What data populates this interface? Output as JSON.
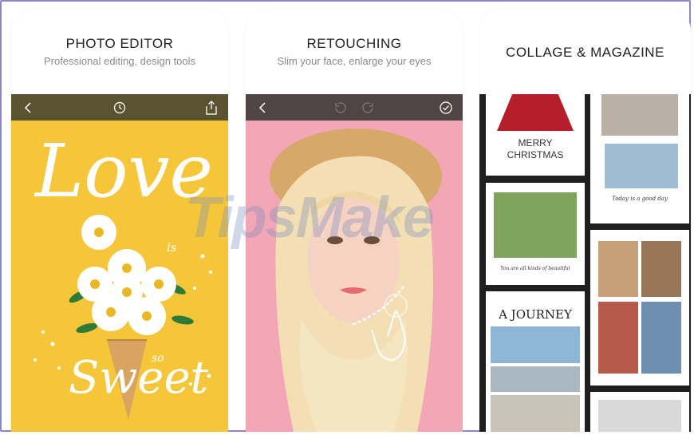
{
  "panels": [
    {
      "title": "PHOTO EDITOR",
      "subtitle": "Professional editing, design tools",
      "toolbar_icons": [
        "back-icon",
        "history-icon",
        "share-icon"
      ],
      "photo": {
        "headline": "Love",
        "small_word": "is",
        "tag_word": "so",
        "script_word": "Sweet"
      }
    },
    {
      "title": "RETOUCHING",
      "subtitle": "Slim your face, enlarge your eyes",
      "toolbar_icons": [
        "back-icon",
        "undo-icon",
        "redo-icon",
        "confirm-icon"
      ]
    },
    {
      "title": "COLLAGE & MAGAZINE",
      "cards": {
        "christmas": {
          "line1": "MERRY",
          "line2": "CHRISTMAS"
        },
        "journey": {
          "headline": "A JOURNEY"
        },
        "today": {
          "caption": "Today is a good day"
        },
        "beautiful": {
          "caption": "You are all kinds of beautiful"
        }
      }
    }
  ],
  "watermark": "TipsMake",
  "colors": {
    "frame_border": "#8a86c9",
    "editor_toolbar": "#5b5231",
    "retouch_toolbar": "#4e4544",
    "yellow_bg": "#f6c63a",
    "pink_bg": "#f2a6b6",
    "collage_bg": "#1f1f1f"
  }
}
